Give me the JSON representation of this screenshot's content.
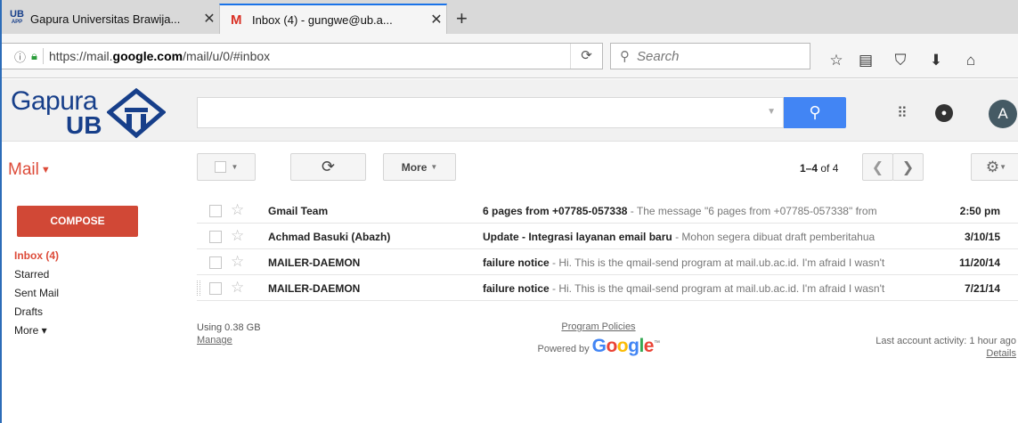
{
  "browser": {
    "tabs": [
      {
        "title": "Gapura Universitas Brawija...",
        "icon": "ub-favicon"
      },
      {
        "title": "Inbox (4) - gungwe@ub.a...",
        "icon": "gmail-favicon",
        "active": true
      }
    ],
    "url_prefix": "https://mail.",
    "url_domain": "google.com",
    "url_suffix": "/mail/u/0/#inbox",
    "search_placeholder": "Search"
  },
  "header": {
    "logo_text": "Gapura",
    "logo_sub": "UB",
    "avatar_letter": "A"
  },
  "toolbar": {
    "mail_label": "Mail",
    "more_label": "More",
    "pager_range": "1–4",
    "pager_of": "of 4"
  },
  "sidebar": {
    "compose_label": "COMPOSE",
    "items": [
      {
        "label": "Inbox (4)",
        "active": true
      },
      {
        "label": "Starred"
      },
      {
        "label": "Sent Mail"
      },
      {
        "label": "Drafts"
      },
      {
        "label": "More ▾"
      }
    ]
  },
  "messages": [
    {
      "sender": "Gmail Team",
      "subject": "6 pages from +07785-057338",
      "snippet": " - The message \"6 pages from +07785-057338\" from",
      "date": "2:50 pm"
    },
    {
      "sender": "Achmad Basuki (Abazh)",
      "subject": "Update - Integrasi layanan email baru",
      "snippet": " - Mohon segera dibuat draft pemberitahua",
      "date": "3/10/15"
    },
    {
      "sender": "MAILER-DAEMON",
      "subject": "failure notice",
      "snippet": " - Hi. This is the qmail-send program at mail.ub.ac.id. I'm afraid I wasn't",
      "date": "11/20/14"
    },
    {
      "sender": "MAILER-DAEMON",
      "subject": "failure notice",
      "snippet": " - Hi. This is the qmail-send program at mail.ub.ac.id. I'm afraid I wasn't",
      "date": "7/21/14"
    }
  ],
  "footer": {
    "usage": "Using 0.38 GB",
    "manage": "Manage",
    "policies": "Program Policies",
    "powered_by": "Powered by",
    "activity": "Last account activity: 1 hour ago",
    "details": "Details"
  },
  "colors": {
    "accent_red": "#dd4b39",
    "compose_red": "#d14836",
    "search_blue": "#4285f4",
    "logo_blue": "#173f8a"
  }
}
